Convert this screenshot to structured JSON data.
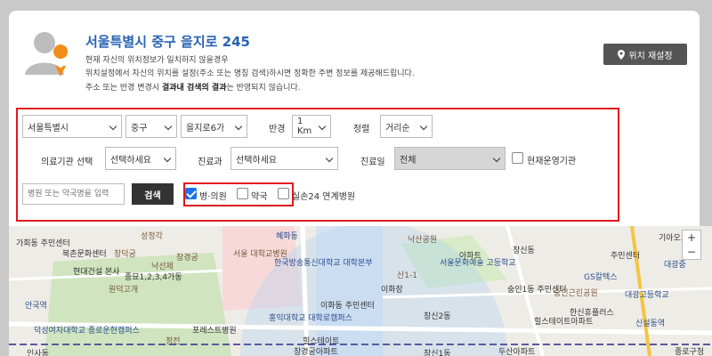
{
  "header": {
    "address": "서울특별시 중구 을지로 245",
    "desc1": "현재 자신의 위치정보가 일치하지 않을경우",
    "desc2": "위치설정에서 자신의 위치를 설정(주소 또는 명칭 검색)하시면 정확한 주변 정보를 제공해드립니다.",
    "desc3_prefix": "주소 또는 반경 변경시 ",
    "desc3_bold": "결과내 검색의 결과",
    "desc3_suffix": "는 반영되지 않습니다.",
    "reset_label": "위치 재설정"
  },
  "filter": {
    "city": "서울특별시",
    "district": "중구",
    "dong": "을지로6가",
    "radius_label": "반경",
    "radius": "1 Km",
    "sort_label": "정렬",
    "sort": "거리순",
    "institution_label": "의료기관 선택",
    "institution": "선택하세요",
    "department_label": "진료과",
    "department": "선택하세요",
    "day_label": "진료일",
    "day": "전체",
    "operating_label": "현재운영기관",
    "search_placeholder": "병원 또는 약국명을 입력",
    "search_button": "검색",
    "chk_hospital": "병·의원",
    "chk_pharmacy": "약국",
    "chk_247": "실손24 연계병원"
  },
  "map": {
    "labels": [
      "가회동 주민센터",
      "북촌문화센터",
      "현대건설 본사",
      "안국역",
      "창덕궁",
      "낙선제",
      "창경궁",
      "종묘1,2,3,4가동",
      "원덕고개",
      "성정각",
      "서울 대학교병원",
      "혜화동",
      "한국방송통신대학교 대학본부",
      "산1-1",
      "이화장",
      "이화동 주민센터",
      "홍익대학교 대학로캠퍼스",
      "덕성여자대학교 종로운현캠퍼스",
      "포레스트병원",
      "힐스테이트",
      "창경궁아파트",
      "정전",
      "인사동",
      "낙산공원",
      "아파트",
      "창신동",
      "서울문화예술 고등학교",
      "GS칼텍스",
      "숭인1동 주민센터",
      "숭인근린공원",
      "한신휴플러스",
      "힐스테이트아파트",
      "신설동역",
      "대광고등학교",
      "창신2동",
      "두산아파트",
      "창신1동",
      "기아오토",
      "주민센터",
      "대광중",
      "종로구청"
    ],
    "colors": {
      "park": "#cfe4bf",
      "water": "#aed2f0",
      "road": "#ffffff",
      "accent": "#e0171f"
    }
  },
  "colors": {
    "title": "#2a63b3",
    "button_dark": "#555555",
    "red": "#e0171f",
    "checkbox_on": "#1a73e8"
  }
}
